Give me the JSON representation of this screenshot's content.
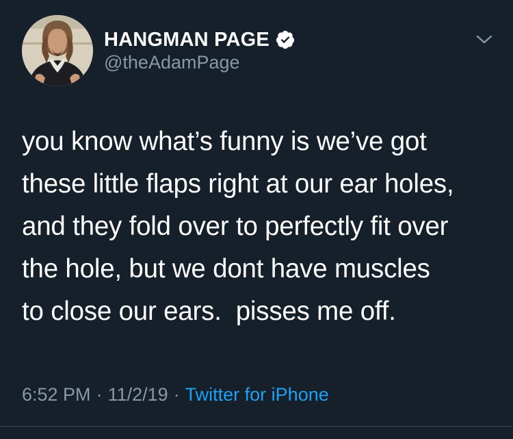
{
  "tweet": {
    "display_name": "HANGMAN PAGE",
    "handle": "@theAdamPage",
    "verified": true,
    "text": "you know what’s funny is we’ve got\nthese little flaps right at our ear holes,\nand they fold over to perfectly fit over\nthe hole, but we dont have muscles\nto close our ears.  pisses me off.",
    "time": "6:52 PM",
    "date": "11/2/19",
    "separator": "·",
    "source": "Twitter for iPhone"
  },
  "icons": {
    "verified": "verified-badge-icon",
    "menu": "chevron-down-icon",
    "avatar": "profile-photo"
  },
  "colors": {
    "background": "#15202b",
    "primary_text": "#ffffff",
    "secondary_text": "#8899a6",
    "link": "#1da1f2",
    "verified_badge": "#ffffff"
  }
}
